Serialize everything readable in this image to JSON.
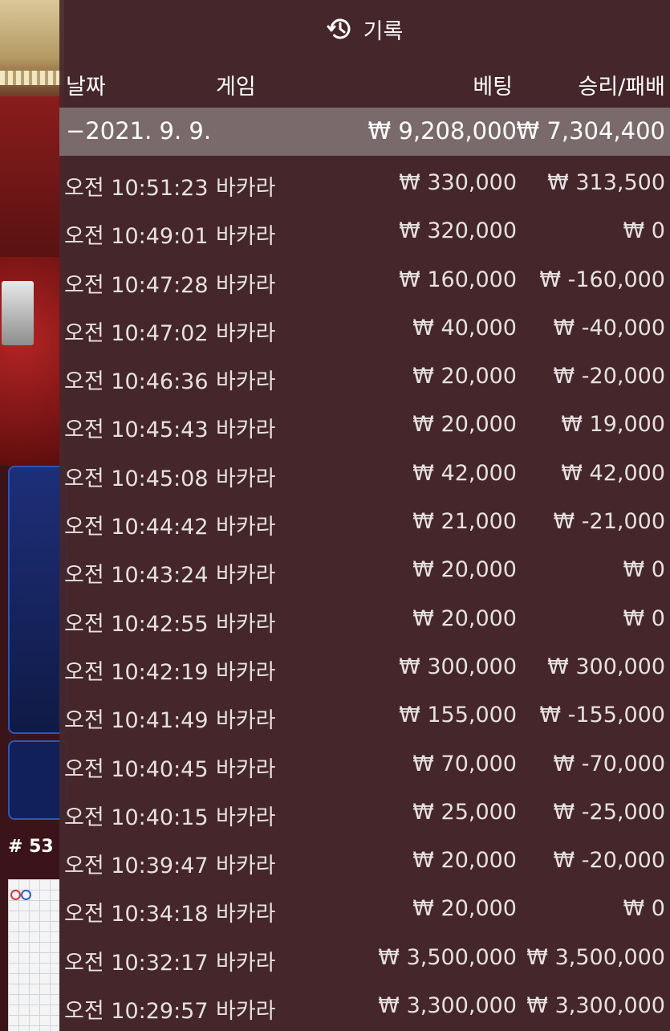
{
  "background": {
    "round_number": "# 53"
  },
  "header": {
    "icon": "history-icon",
    "title": "기록"
  },
  "columns": {
    "date": "날짜",
    "game": "게임",
    "bet": "베팅",
    "win_loss": "승리/패배"
  },
  "group": {
    "date": "−2021. 9. 9.",
    "total_bet": "₩ 9,208,000",
    "total_win_loss": "₩ 7,304,400"
  },
  "rows": [
    {
      "time": "오전 10:51:23",
      "game": "바카라",
      "bet": "₩ 330,000",
      "win_loss": "₩ 313,500"
    },
    {
      "time": "오전 10:49:01",
      "game": "바카라",
      "bet": "₩ 320,000",
      "win_loss": "₩ 0"
    },
    {
      "time": "오전 10:47:28",
      "game": "바카라",
      "bet": "₩ 160,000",
      "win_loss": "₩ -160,000"
    },
    {
      "time": "오전 10:47:02",
      "game": "바카라",
      "bet": "₩ 40,000",
      "win_loss": "₩ -40,000"
    },
    {
      "time": "오전 10:46:36",
      "game": "바카라",
      "bet": "₩ 20,000",
      "win_loss": "₩ -20,000"
    },
    {
      "time": "오전 10:45:43",
      "game": "바카라",
      "bet": "₩ 20,000",
      "win_loss": "₩ 19,000"
    },
    {
      "time": "오전 10:45:08",
      "game": "바카라",
      "bet": "₩ 42,000",
      "win_loss": "₩ 42,000"
    },
    {
      "time": "오전 10:44:42",
      "game": "바카라",
      "bet": "₩ 21,000",
      "win_loss": "₩ -21,000"
    },
    {
      "time": "오전 10:43:24",
      "game": "바카라",
      "bet": "₩ 20,000",
      "win_loss": "₩ 0"
    },
    {
      "time": "오전 10:42:55",
      "game": "바카라",
      "bet": "₩ 20,000",
      "win_loss": "₩ 0"
    },
    {
      "time": "오전 10:42:19",
      "game": "바카라",
      "bet": "₩ 300,000",
      "win_loss": "₩ 300,000"
    },
    {
      "time": "오전 10:41:49",
      "game": "바카라",
      "bet": "₩ 155,000",
      "win_loss": "₩ -155,000"
    },
    {
      "time": "오전 10:40:45",
      "game": "바카라",
      "bet": "₩ 70,000",
      "win_loss": "₩ -70,000"
    },
    {
      "time": "오전 10:40:15",
      "game": "바카라",
      "bet": "₩ 25,000",
      "win_loss": "₩ -25,000"
    },
    {
      "time": "오전 10:39:47",
      "game": "바카라",
      "bet": "₩ 20,000",
      "win_loss": "₩ -20,000"
    },
    {
      "time": "오전 10:34:18",
      "game": "바카라",
      "bet": "₩ 20,000",
      "win_loss": "₩ 0"
    },
    {
      "time": "오전 10:32:17",
      "game": "바카라",
      "bet": "₩ 3,500,000",
      "win_loss": "₩ 3,500,000"
    },
    {
      "time": "오전 10:29:57",
      "game": "바카라",
      "bet": "₩ 3,300,000",
      "win_loss": "₩ 3,300,000"
    }
  ]
}
